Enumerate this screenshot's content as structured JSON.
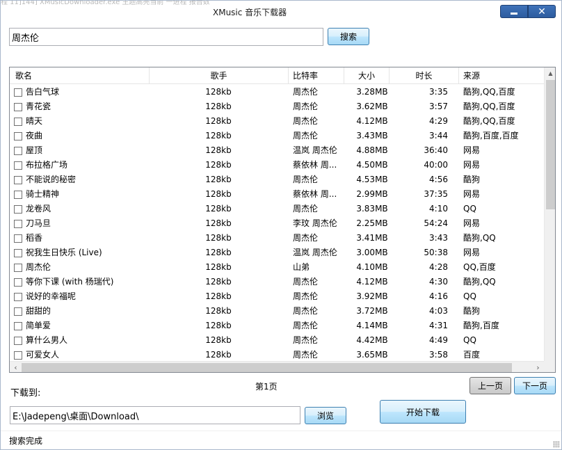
{
  "window": {
    "title": "XMusic 音乐下载器",
    "background_taskbar_text": "程  11]144] XMusicDownloader.exe     主题高亮当前  一进程     报告数量"
  },
  "search": {
    "query": "周杰伦",
    "button_label": "搜索"
  },
  "table": {
    "columns": [
      "歌名",
      "歌手",
      "比特率",
      "大小",
      "时长",
      "来源"
    ],
    "rows": [
      {
        "name": "告白气球",
        "singer": "128kb",
        "bitrate": "周杰伦",
        "size": "3.28MB",
        "duration": "3:35",
        "source": "酷狗,QQ,百度"
      },
      {
        "name": "青花瓷",
        "singer": "128kb",
        "bitrate": "周杰伦",
        "size": "3.62MB",
        "duration": "3:57",
        "source": "酷狗,QQ,百度"
      },
      {
        "name": "晴天",
        "singer": "128kb",
        "bitrate": "周杰伦",
        "size": "4.12MB",
        "duration": "4:29",
        "source": "酷狗,QQ,百度"
      },
      {
        "name": "夜曲",
        "singer": "128kb",
        "bitrate": "周杰伦",
        "size": "3.43MB",
        "duration": "3:44",
        "source": "酷狗,百度,百度"
      },
      {
        "name": "屋顶",
        "singer": "128kb",
        "bitrate": "温岚 周杰伦",
        "size": "4.88MB",
        "duration": "36:40",
        "source": "网易"
      },
      {
        "name": "布拉格广场",
        "singer": "128kb",
        "bitrate": "蔡依林 周...",
        "size": "4.50MB",
        "duration": "40:00",
        "source": "网易"
      },
      {
        "name": "不能说的秘密",
        "singer": "128kb",
        "bitrate": "周杰伦",
        "size": "4.53MB",
        "duration": "4:56",
        "source": "酷狗"
      },
      {
        "name": "骑士精神",
        "singer": "128kb",
        "bitrate": "蔡依林 周...",
        "size": "2.99MB",
        "duration": "37:35",
        "source": "网易"
      },
      {
        "name": "龙卷风",
        "singer": "128kb",
        "bitrate": "周杰伦",
        "size": "3.83MB",
        "duration": "4:10",
        "source": "QQ"
      },
      {
        "name": "刀马旦",
        "singer": "128kb",
        "bitrate": "李玟 周杰伦",
        "size": "2.25MB",
        "duration": "54:24",
        "source": "网易"
      },
      {
        "name": "稻香",
        "singer": "128kb",
        "bitrate": "周杰伦",
        "size": "3.41MB",
        "duration": "3:43",
        "source": "酷狗,QQ"
      },
      {
        "name": "祝我生日快乐 (Live)",
        "singer": "128kb",
        "bitrate": "温岚 周杰伦",
        "size": "3.00MB",
        "duration": "50:38",
        "source": "网易"
      },
      {
        "name": "周杰伦",
        "singer": "128kb",
        "bitrate": "山弟",
        "size": "4.10MB",
        "duration": "4:28",
        "source": "QQ,百度"
      },
      {
        "name": "等你下课 (with 杨瑞代)",
        "singer": "128kb",
        "bitrate": "周杰伦",
        "size": "4.12MB",
        "duration": "4:30",
        "source": "酷狗,QQ"
      },
      {
        "name": "说好的幸福呢",
        "singer": "128kb",
        "bitrate": "周杰伦",
        "size": "3.92MB",
        "duration": "4:16",
        "source": "QQ"
      },
      {
        "name": "甜甜的",
        "singer": "128kb",
        "bitrate": "周杰伦",
        "size": "3.72MB",
        "duration": "4:03",
        "source": "酷狗"
      },
      {
        "name": "简单爱",
        "singer": "128kb",
        "bitrate": "周杰伦",
        "size": "4.14MB",
        "duration": "4:31",
        "source": "酷狗,百度"
      },
      {
        "name": "算什么男人",
        "singer": "128kb",
        "bitrate": "周杰伦",
        "size": "4.42MB",
        "duration": "4:49",
        "source": "QQ"
      },
      {
        "name": "可爱女人",
        "singer": "128kb",
        "bitrate": "周杰伦",
        "size": "3.65MB",
        "duration": "3:58",
        "source": "百度"
      }
    ]
  },
  "download": {
    "label": "下载到:",
    "path": "E:\\Jadepeng\\桌面\\Download\\",
    "browse_label": "浏览",
    "start_label": "开始下载"
  },
  "pagination": {
    "page_text": "第1页",
    "prev_label": "上一页",
    "next_label": "下一页"
  },
  "status": {
    "text": "搜索完成"
  },
  "colors": {
    "window_button": "#2c5c9f",
    "button_border": "#3c7fb1",
    "scroll_thumb": "#cdcdcd"
  }
}
